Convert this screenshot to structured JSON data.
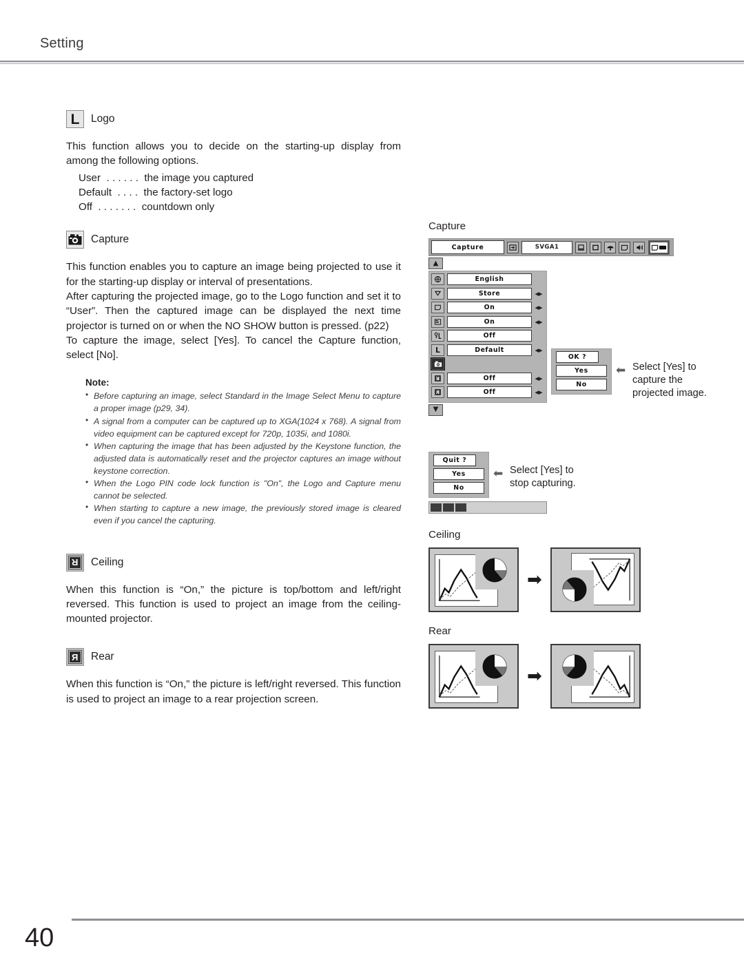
{
  "header": {
    "chapter": "Setting"
  },
  "footer": {
    "page_number": "40"
  },
  "sections": {
    "logo": {
      "icon_name": "logo-icon",
      "icon_glyph": "L",
      "title": "Logo",
      "body": "This function allows you to decide on the starting-up display from among the following options.",
      "options": [
        "User  . . . . . .  the image you captured",
        "Default  . . . .  the factory-set logo",
        "Off  . . . . . . .  countdown only"
      ]
    },
    "capture": {
      "icon_name": "capture-camera-icon",
      "title": "Capture",
      "paragraphs": [
        "This function enables you to capture an image being projected to use it for the starting-up display or interval of presentations.",
        "After capturing the projected image, go to the Logo function and set it to “User”. Then the captured image can be displayed the next time projector is turned on or when the NO SHOW button is pressed. (p22)",
        "To capture the image, select [Yes]. To cancel the Capture function, select [No]."
      ],
      "note": {
        "title": "Note:",
        "items": [
          "Before capturing an image, select Standard in the Image Select Menu to capture a proper image (p29, 34).",
          "A signal from a computer can be captured up to XGA(1024 x 768). A signal from video equipment can be captured except for 720p, 1035i, and 1080i.",
          "When capturing the image that has been adjusted by the Keystone function, the adjusted data is automatically reset and the projector captures an image without keystone correction.",
          "When the Logo PIN code lock function is \"On\", the Logo and Capture menu cannot be selected.",
          "When starting to capture a new image, the previously stored image is cleared even if you cancel the capturing."
        ]
      }
    },
    "ceiling": {
      "icon_name": "ceiling-icon",
      "title": "Ceiling",
      "body": "When this function is “On,” the picture is top/bottom and left/right reversed. This function is used to project an image from the ceiling-mounted projector."
    },
    "rear": {
      "icon_name": "rear-icon",
      "title": "Rear",
      "body": "When this function is “On,” the picture is left/right reversed. This function is used to project an image to a rear projection screen."
    }
  },
  "osd": {
    "caption": "Capture",
    "menu_bar": {
      "title": "Capture",
      "source_value": "SVGA1",
      "icons": [
        "input-icon",
        "computer-icon",
        "screen-icon",
        "color-icon",
        "image-icon",
        "sound-icon",
        "setting-icon"
      ]
    },
    "scroll_up": "▲",
    "scroll_down": "▼",
    "rows": [
      {
        "icon": "language-globe-icon",
        "value": "English",
        "adjustable": false
      },
      {
        "icon": "lamp-mode-icon",
        "value": "Store",
        "adjustable": true
      },
      {
        "icon": "display-icon",
        "value": "On",
        "adjustable": true
      },
      {
        "icon": "menu-position-icon",
        "value": "On",
        "adjustable": true
      },
      {
        "icon": "pin-code-lock-icon",
        "value": "Off",
        "adjustable": false
      },
      {
        "icon": "logo-icon",
        "value": "Default",
        "adjustable": true
      },
      {
        "icon": "capture-icon",
        "value": "",
        "adjustable": false,
        "selected": true
      },
      {
        "icon": "ceiling-icon",
        "value": "Off",
        "adjustable": true
      },
      {
        "icon": "rear-icon",
        "value": "Off",
        "adjustable": true
      }
    ],
    "capture_dialog": {
      "prompt": "OK ?",
      "yes": "Yes",
      "no": "No",
      "annotation": "Select [Yes] to\ncapture the\nprojected image."
    },
    "quit_dialog": {
      "prompt": "Quit ?",
      "yes": "Yes",
      "no": "No",
      "annotation": "Select [Yes] to\nstop capturing."
    },
    "progress": {
      "blocks_filled": 3,
      "blocks_total": 10
    }
  },
  "illustrations": {
    "ceiling_label": "Ceiling",
    "rear_label": "Rear",
    "transform_arrow": "➡"
  },
  "colors": {
    "rule": "#8d8f93",
    "text": "#231f20",
    "osd_gray": "#b4b4b4",
    "osd_bar_gray": "#a5a5a5"
  }
}
